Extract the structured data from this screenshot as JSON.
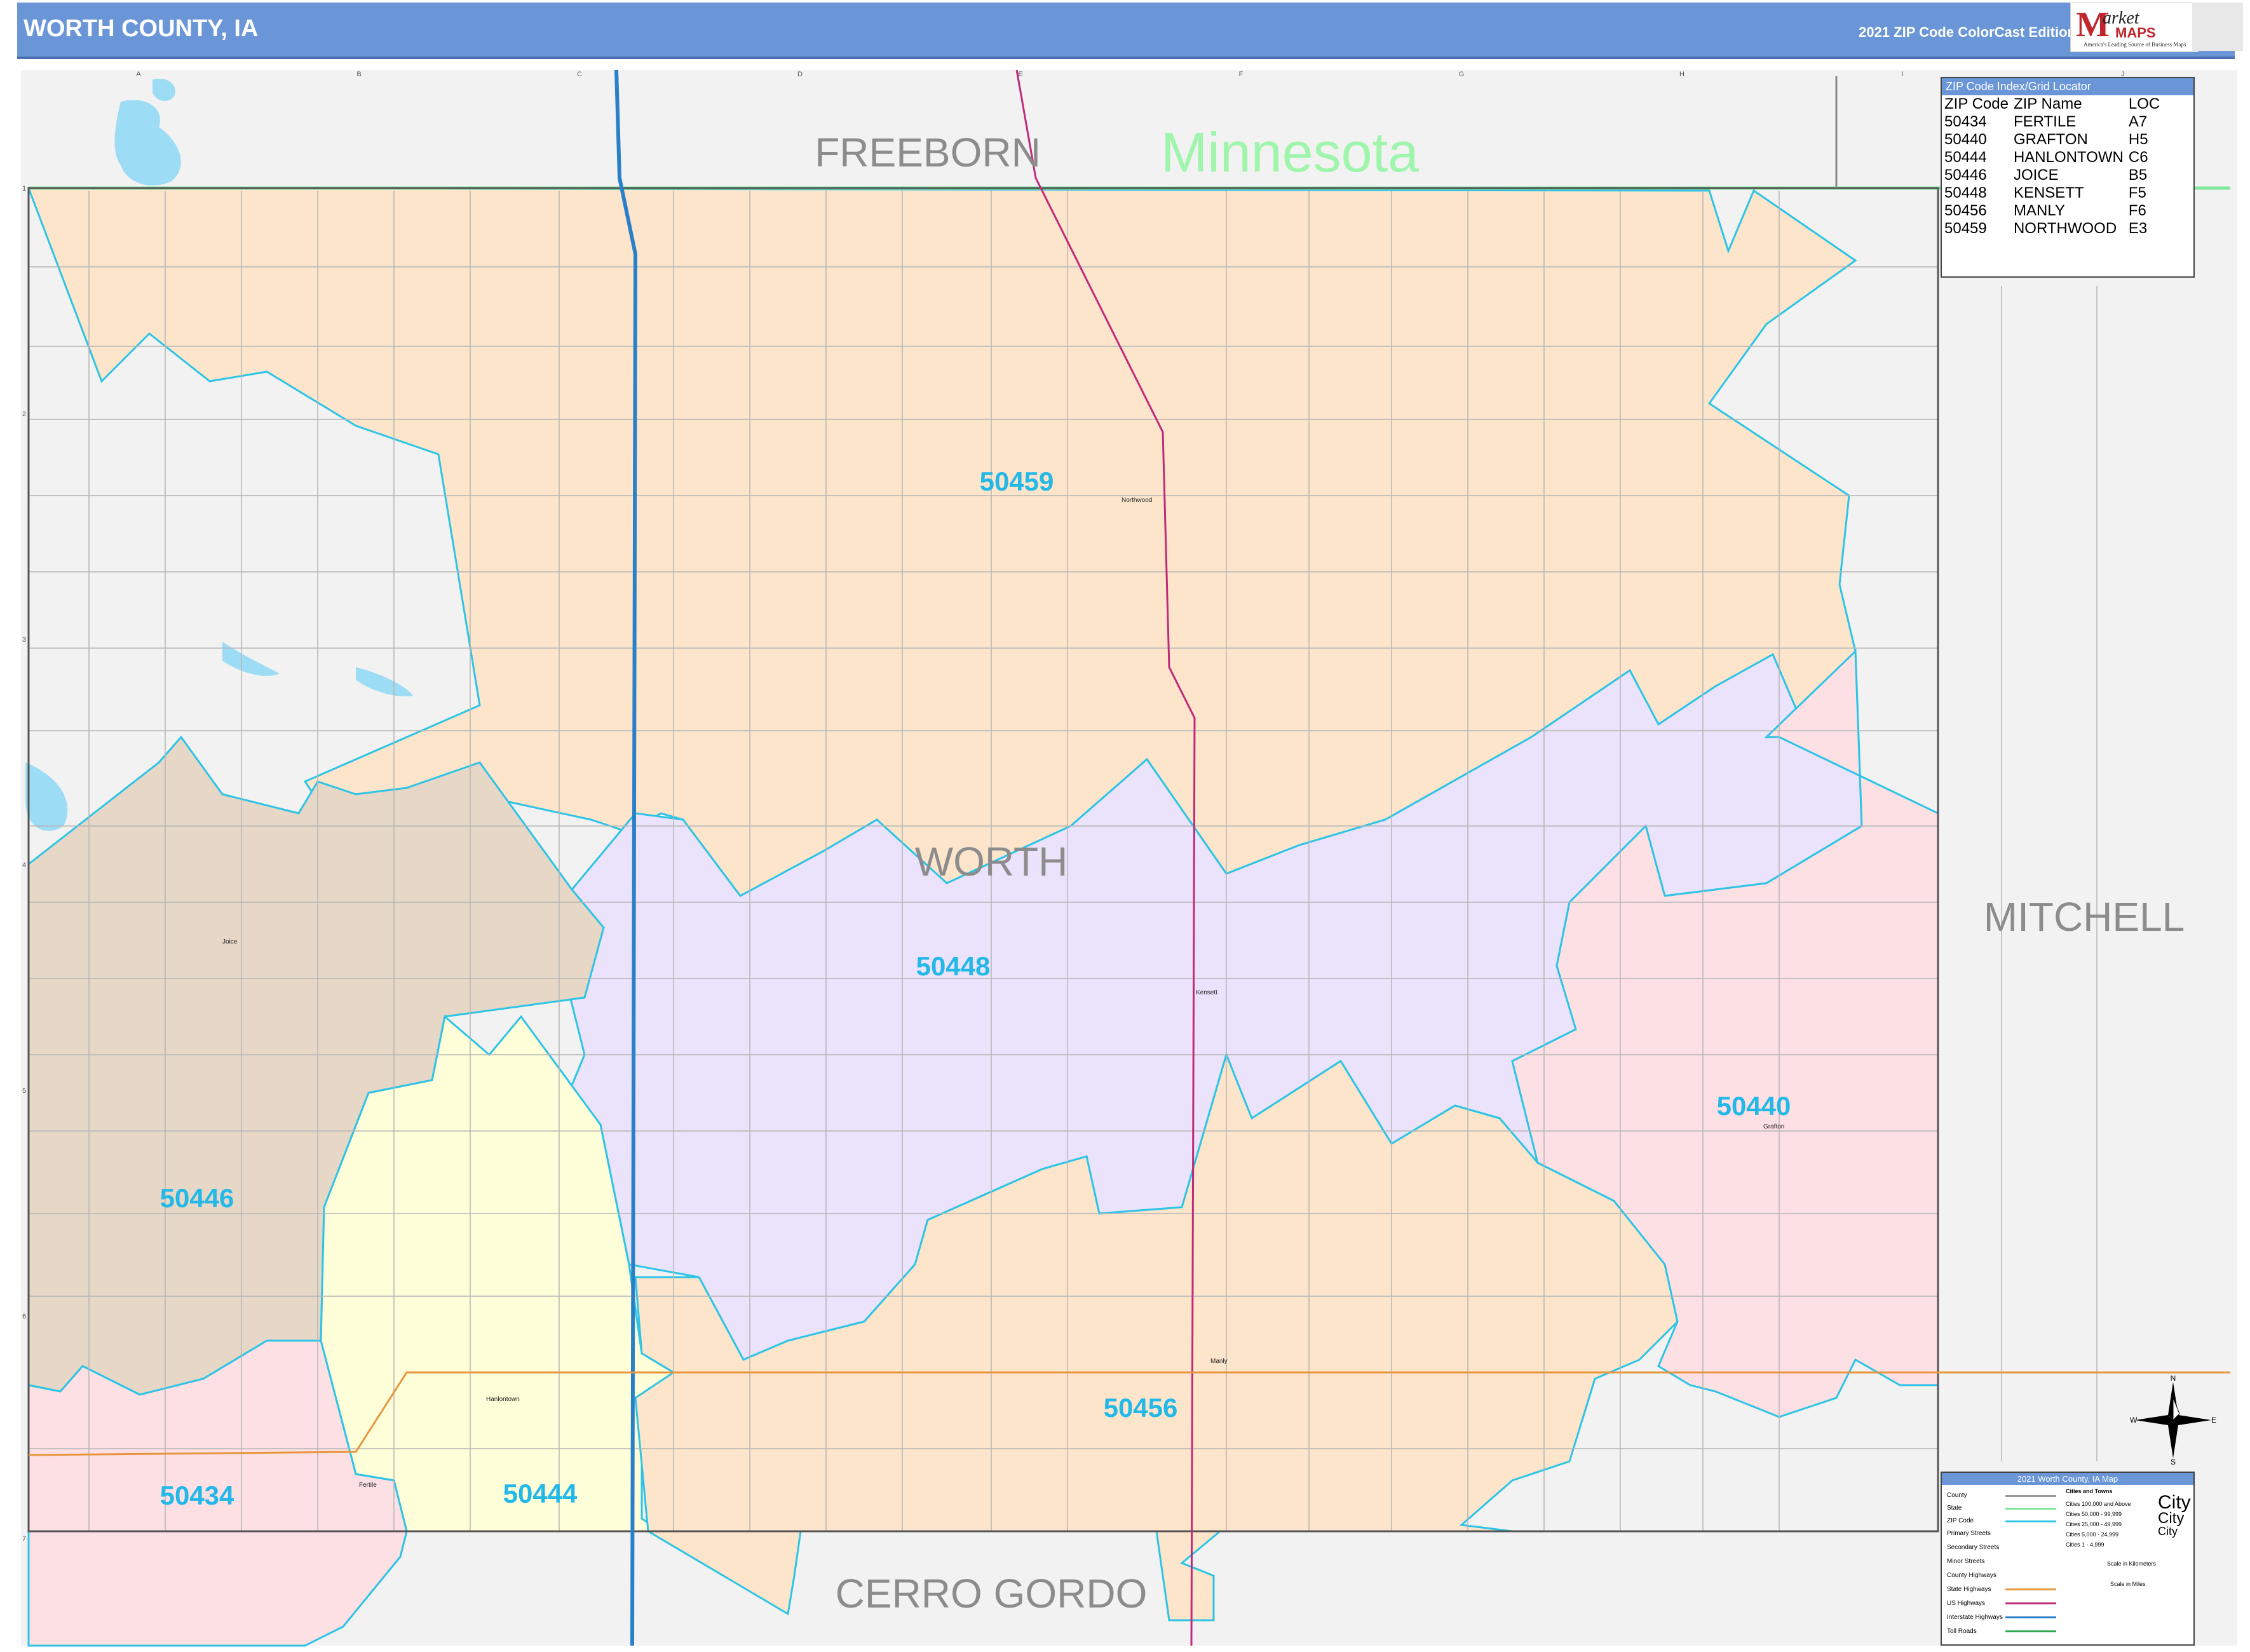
{
  "header": {
    "title": "WORTH COUNTY, IA",
    "edition": "2021 ZIP Code ColorCast Edition",
    "logo_letter": "M",
    "logo_word": "arket",
    "logo_maps": "MAPS",
    "logo_tagline": "America's Leading Source of Business Maps"
  },
  "map": {
    "state_label": "Minnesota",
    "counties": [
      "FREEBORN",
      "WORTH",
      "MITCHELL",
      "CERRO GORDO"
    ],
    "zip_labels": [
      "50459",
      "50448",
      "50446",
      "50440",
      "50456",
      "50444",
      "50434"
    ],
    "towns": [
      "Northwood",
      "Kensett",
      "Joice",
      "Grafton",
      "Manly",
      "Hanlontown",
      "Fertile"
    ],
    "grid_cols": [
      "A",
      "B",
      "C",
      "D",
      "E",
      "F",
      "G",
      "H",
      "I",
      "J"
    ],
    "grid_rows": [
      "1",
      "2",
      "3",
      "4",
      "5",
      "6",
      "7"
    ],
    "zip_colors": {
      "50459": "#fde5cc",
      "50448": "#ebe3fb",
      "50446": "#e6d7c7",
      "50440": "#fde0e4",
      "50456": "#fde5cc",
      "50444": "#fefed8",
      "50434": "#fde0e4"
    }
  },
  "index": {
    "title": "ZIP Code Index/Grid Locator",
    "headers": [
      "ZIP Code",
      "ZIP Name",
      "LOC"
    ],
    "rows": [
      [
        "50434",
        "FERTILE",
        "A7"
      ],
      [
        "50440",
        "GRAFTON",
        "H5"
      ],
      [
        "50444",
        "HANLONTOWN",
        "C6"
      ],
      [
        "50446",
        "JOICE",
        "B5"
      ],
      [
        "50448",
        "KENSETT",
        "F5"
      ],
      [
        "50456",
        "MANLY",
        "F6"
      ],
      [
        "50459",
        "NORTHWOOD",
        "E3"
      ]
    ]
  },
  "legend": {
    "title": "2021 Worth County, IA Map",
    "items": [
      "County",
      "State",
      "ZIP Code",
      "Primary Streets",
      "Secondary Streets",
      "Minor Streets",
      "County Highways",
      "State Highways",
      "US Highways",
      "Interstate Highways",
      "Toll Roads"
    ],
    "cities_title": "Cities and Towns",
    "cities": [
      "Cities 100,000 and Above",
      "Cities 50,000 - 99,999",
      "Cities 25,000 - 49,999",
      "Cities 5,000 - 24,999",
      "Cities 1 - 4,999"
    ],
    "city_symbol": "City",
    "scale_km": "Scale in Kilometers",
    "scale_mi": "Scale in Miles"
  },
  "compass": {
    "n": "N",
    "s": "S",
    "e": "E",
    "w": "W"
  }
}
